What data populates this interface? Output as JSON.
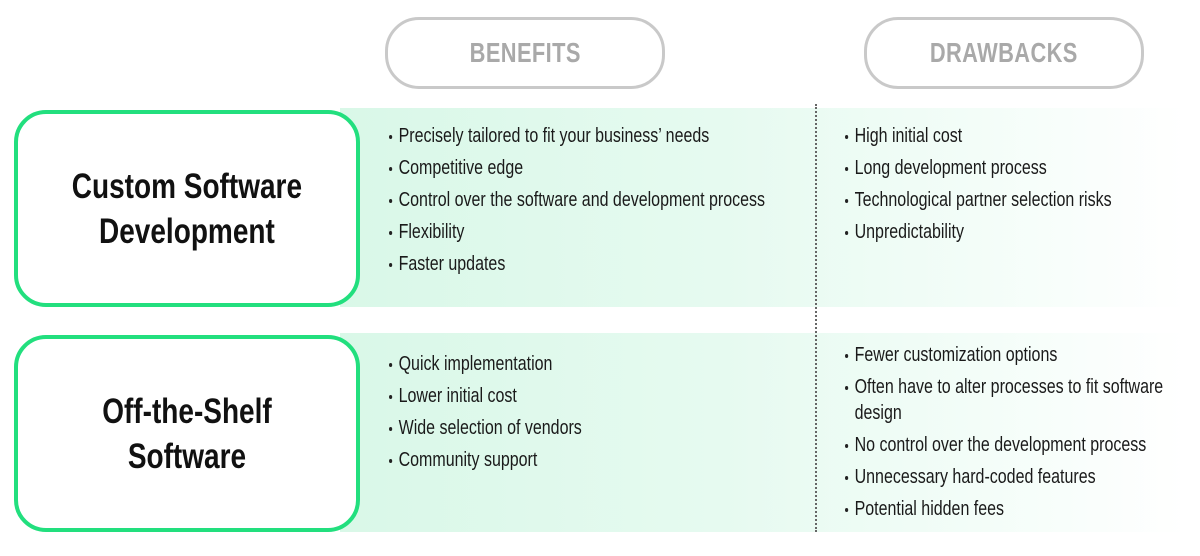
{
  "headers": {
    "benefits": "BENEFITS",
    "drawbacks": "DRAWBACKS"
  },
  "colors": {
    "accent_border": "#22df7e",
    "band": "#d9f8e8",
    "pill_border": "#c9c9c9",
    "pill_text": "#a9a9a9"
  },
  "rows": [
    {
      "title_line1": "Custom Software",
      "title_line2": "Development",
      "benefits": [
        "Precisely tailored to fit your business’ needs",
        "Competitive edge",
        "Control over the software and development process",
        "Flexibility",
        "Faster updates"
      ],
      "drawbacks": [
        "High initial cost",
        "Long development process",
        "Technological partner selection risks",
        "Unpredictability"
      ]
    },
    {
      "title_line1": "Off-the-Shelf",
      "title_line2": "Software",
      "benefits": [
        "Quick implementation",
        "Lower initial cost",
        "Wide selection of vendors",
        "Community support"
      ],
      "drawbacks": [
        "Fewer customization options",
        "Often have to alter processes to fit software design",
        "No control over the development process",
        "Unnecessary hard-coded features",
        "Potential hidden fees"
      ]
    }
  ]
}
